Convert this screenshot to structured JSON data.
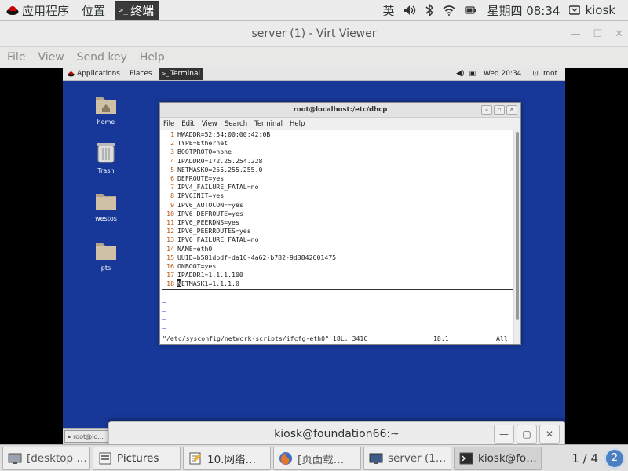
{
  "host_top": {
    "apps_label": "应用程序",
    "places_label": "位置",
    "terminal_label": "终端",
    "ime_label": "英",
    "datetime": "星期四 08:34",
    "user": "kiosk"
  },
  "viewer": {
    "title": "server (1) - Virt Viewer",
    "menu": [
      "File",
      "View",
      "Send key",
      "Help"
    ]
  },
  "guest": {
    "applications": "Applications",
    "places": "Places",
    "terminal": "Terminal",
    "clock": "Wed 20:34",
    "user": "root",
    "icons": [
      "home",
      "Trash",
      "westos",
      "pts"
    ],
    "task_item": "root@lo..."
  },
  "terminal": {
    "title": "root@localhost:/etc/dhcp",
    "menu": [
      "File",
      "Edit",
      "View",
      "Search",
      "Terminal",
      "Help"
    ],
    "lines": [
      "HWADDR=52:54:00:00:42:0B",
      "TYPE=Ethernet",
      "BOOTPROTO=none",
      "IPADDR0=172.25.254.228",
      "NETMASK0=255.255.255.0",
      "DEFROUTE=yes",
      "IPV4_FAILURE_FATAL=no",
      "IPV6INIT=yes",
      "IPV6_AUTOCONF=yes",
      "IPV6_DEFROUTE=yes",
      "IPV6_PEERDNS=yes",
      "IPV6_PEERROUTES=yes",
      "IPV6_FAILURE_FATAL=no",
      "NAME=eth0",
      "UUID=b581dbdf-da16-4a62-b782-9d3842601475",
      "ONBOOT=yes",
      "IPADDR1=1.1.1.100",
      "NETMASK1=1.1.1.0"
    ],
    "line_numbers": [
      "1",
      "2",
      "3",
      "4",
      "5",
      "6",
      "7",
      "8",
      "9",
      "10",
      "11",
      "12",
      "13",
      "14",
      "15",
      "16",
      "17",
      "18"
    ],
    "tilde": "~",
    "status_file": "\"/etc/sysconfig/network-scripts/ifcfg-eth0\" 18L, 341C",
    "status_pos": "18,1",
    "status_view": "All"
  },
  "overlay": {
    "title": "kiosk@foundation66:~"
  },
  "taskbar": {
    "items": [
      "[desktop …",
      "Pictures",
      "10.网络…",
      "[页面载…",
      "server (1…",
      "kiosk@fo…"
    ],
    "pager": "1 / 4",
    "badge": "2"
  }
}
